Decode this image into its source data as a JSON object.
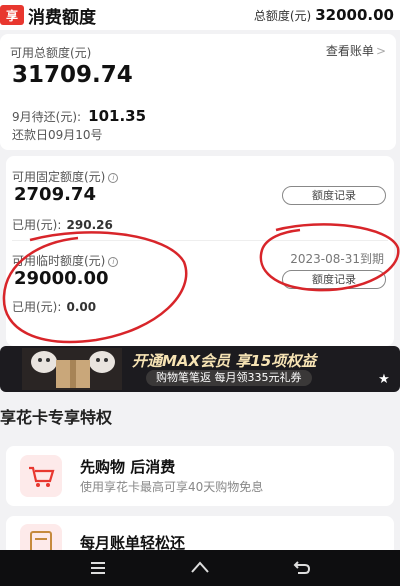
{
  "header": {
    "logo_text": "享",
    "title": "消费额度",
    "total_label": "总额度(元)",
    "total_amount": "32000.00"
  },
  "summary": {
    "available_total_label": "可用总额度(元)",
    "available_total": "31709.74",
    "view_bill_label": "查看账单",
    "due_label": "9月待还(元):",
    "due_amount": "101.35",
    "repay_date": "还款日09月10号"
  },
  "fixed_quota": {
    "label": "可用固定额度(元)",
    "amount": "2709.74",
    "record_button": "额度记录",
    "used_label": "已用(元):",
    "used_amount": "290.26"
  },
  "temp_quota": {
    "label": "可用临时额度(元)",
    "amount": "29000.00",
    "expiry": "2023-08-31到期",
    "record_button": "额度记录",
    "used_label": "已用(元):",
    "used_amount": "0.00"
  },
  "banner": {
    "headline": "开通MAX会员 享15项权益",
    "subline": "购物笔笔返 每月领335元礼券"
  },
  "privileges": {
    "section_title": "享花卡专享特权",
    "items": [
      {
        "title": "先购物 后消费",
        "desc": "使用享花卡最高可享40天购物免息",
        "icon": "shopping-cart-icon"
      },
      {
        "title": "每月账单轻松还",
        "desc": "",
        "icon": "bill-icon"
      }
    ]
  },
  "colors": {
    "brand_red": "#e8372f",
    "annotation_red": "#d8252a",
    "banner_gold": "#f6e3b4"
  }
}
